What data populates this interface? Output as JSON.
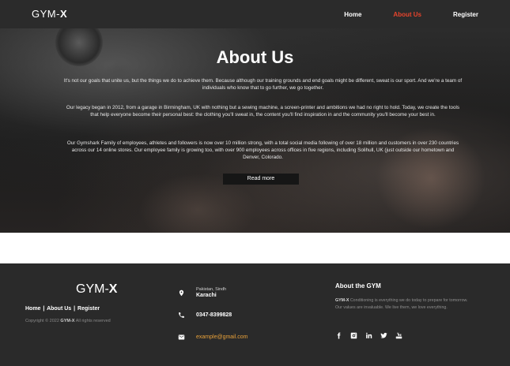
{
  "navbar": {
    "brand_prefix": "GYM-",
    "brand_suffix": "X",
    "links": [
      {
        "label": "Home"
      },
      {
        "label": "About Us"
      },
      {
        "label": "Register"
      }
    ],
    "active_color": "#e8442c"
  },
  "hero": {
    "title": "About Us",
    "paragraphs": [
      "It's not our goals that unite us, but the things we do to achieve them. Because although our training grounds and end goals might be different, sweat is our sport. And we're a team of individuals who know that to go further, we go together.",
      "Our legacy began in 2012, from a garage in Birmingham, UK with nothing but a sewing machine, a screen-printer and ambitions we had no right to hold. Today, we create the tools that help everyone become their personal best: the clothing you'll sweat in, the content you'll find inspiration in and the community you'll become your best in.",
      "Our Gymshark Family of employees, athletes and followers is now over 10 million strong, with a total social media following of over 18 million and customers in over 230 countries across our 14 online stores. Our employee family is growing too, with over 900 employees across offices in five regions, including Solihull, UK (just outside our hometown and Denver, Colorado."
    ],
    "read_more_label": "Read more"
  },
  "footer": {
    "brand_prefix": "GYM-",
    "brand_suffix": "X",
    "links": {
      "home": "Home",
      "about": "About Us",
      "register": "Register",
      "separator": "|"
    },
    "copyright_prefix": "Copyright © 2022",
    "copyright_brand": "GYM-X",
    "copyright_suffix": "All rights reserved",
    "location_region": "Pakistan, Sindh",
    "location_city": "Karachi",
    "phone": "0347-8399828",
    "email": "example@gmail.com",
    "email_color": "#e8a13a",
    "about_title": "About the GYM",
    "about_brand": "GYM-X",
    "about_text_1": "Conditioning is everything we do today to prepare for tomorrow.",
    "about_text_2": "Our values are invaluable. We live them, we love everything.",
    "social_icons": [
      "facebook-icon",
      "instagram-icon",
      "linkedin-icon",
      "twitter-icon",
      "youtube-icon"
    ]
  }
}
